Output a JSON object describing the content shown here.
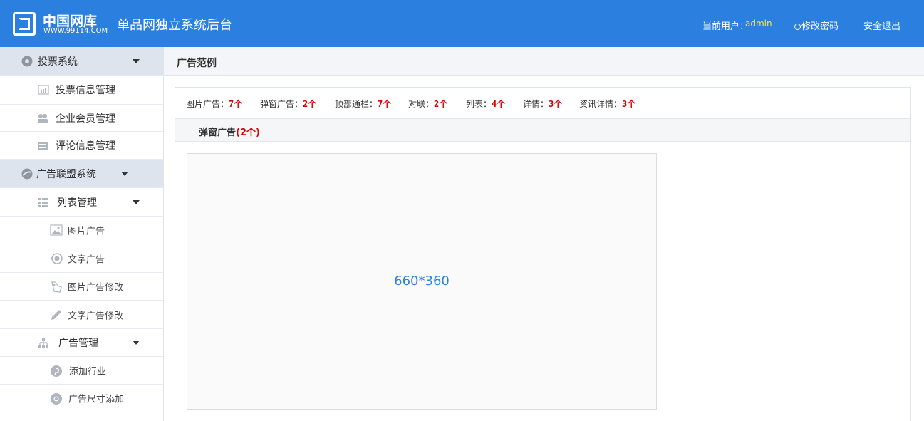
{
  "header": {
    "logo_cn": "中国网库",
    "logo_url": "WWW.99114.COM",
    "system_title": "单品网独立系统后台",
    "current_user_label": "当前用户：",
    "username": "admin",
    "change_password": "修改密码",
    "logout": "安全退出"
  },
  "sidebar": {
    "items": [
      {
        "label": "投票系统",
        "type": "group",
        "icon": "vote-icon",
        "expanded": true
      },
      {
        "label": "投票信息管理",
        "type": "sub",
        "icon": "bar-chart-icon"
      },
      {
        "label": "企业会员管理",
        "type": "sub",
        "icon": "users-icon"
      },
      {
        "label": "评论信息管理",
        "type": "sub",
        "icon": "calendar-icon"
      },
      {
        "label": "广告联盟系统",
        "type": "group",
        "icon": "globe-icon",
        "expanded": true
      },
      {
        "label": "列表管理",
        "type": "sub",
        "icon": "list-icon",
        "expanded": true
      },
      {
        "label": "图片广告",
        "type": "sub2",
        "icon": "image-icon"
      },
      {
        "label": "文字广告",
        "type": "sub2",
        "icon": "text-ad-icon"
      },
      {
        "label": "图片广告修改",
        "type": "sub2",
        "icon": "edit-image-icon"
      },
      {
        "label": "文字广告修改",
        "type": "sub2",
        "icon": "pencil-icon"
      },
      {
        "label": "广告管理",
        "type": "sub",
        "icon": "sitemap-icon",
        "expanded": true
      },
      {
        "label": "添加行业",
        "type": "sub2",
        "icon": "pinterest-icon"
      },
      {
        "label": "广告尺寸添加",
        "type": "sub2",
        "icon": "chrome-icon"
      }
    ]
  },
  "breadcrumb": {
    "title": "广告范例"
  },
  "stats": [
    {
      "label": "图片广告：",
      "count": "7个"
    },
    {
      "label": "弹窗广告：",
      "count": "2个"
    },
    {
      "label": "顶部通栏：",
      "count": "7个"
    },
    {
      "label": "对联：",
      "count": "2个"
    },
    {
      "label": "列表：",
      "count": "4个"
    },
    {
      "label": "详情：",
      "count": "3个"
    },
    {
      "label": "资讯详情：",
      "count": "3个"
    }
  ],
  "section": {
    "title": "弹窗广告",
    "count": "(2个)"
  },
  "ad_placeholder": {
    "size_text": "660*360"
  },
  "colors": {
    "header_bg": "#2b7fde",
    "accent_red": "#d40000",
    "username": "#f5e25a"
  }
}
